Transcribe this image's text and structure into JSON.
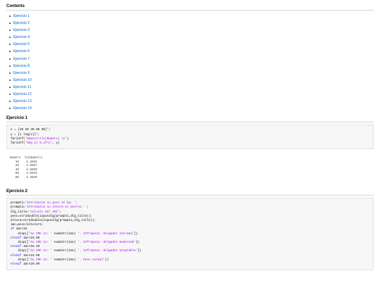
{
  "contents": {
    "title": "Contents",
    "items": [
      "Ejercicio 1",
      "Ejercicio 2",
      "Ejercicio 3",
      "Ejercicio 4",
      "Ejercicio 5",
      "Ejercicio 6",
      "Ejercicio 7",
      "Ejercicio 8",
      "Ejercicio 9",
      "Ejercicio 10",
      "Ejercicio 11",
      "Ejercicio 12",
      "Ejercicio 13",
      "Ejercicio 14"
    ]
  },
  "section1": {
    "title": "Ejercicio 1",
    "code": [
      [
        [
          "x = [10 20 40 60 80]';",
          ""
        ]
      ],
      [
        [
          "y = [x log(x)]';",
          ""
        ]
      ],
      [
        [
          "fprintf(",
          ""
        ],
        [
          "'Numero\\tln(Numero) \\n'",
          "str"
        ],
        [
          ")",
          ""
        ]
      ],
      [
        [
          "fprintf(",
          ""
        ],
        [
          "'%5g it %.4f\\n'",
          "str"
        ],
        [
          ", y)",
          ""
        ]
      ]
    ],
    "output": [
      "Numero  ln(Numero)",
      "   10    2.3026",
      "   20    2.9957",
      "   40    3.6889",
      "   60    4.0943",
      "   80    4.3820"
    ]
  },
  "section2": {
    "title": "Ejercicio 2",
    "code": [
      [
        [
          "prompt1=",
          ""
        ],
        [
          "'Introduzca su peso en kg: '",
          "str"
        ],
        [
          ";",
          ""
        ]
      ],
      [
        [
          "prompt2=",
          ""
        ],
        [
          "'Introduzca su altura en metros: '",
          "str"
        ],
        [
          ";",
          ""
        ]
      ],
      [
        [
          "dlg_title=",
          ""
        ],
        [
          "'Calculo del IMC'",
          "str"
        ],
        [
          ";",
          ""
        ]
      ],
      [
        [
          "peso=str2double(inputdlg(prompt1,dlg_title));",
          ""
        ]
      ],
      [
        [
          "altura=str2double(inputdlg(prompt2,dlg_title));",
          ""
        ]
      ],
      [
        [
          "imc=peso/altura^2;",
          ""
        ]
      ],
      [
        [
          "if",
          "kw"
        ],
        [
          " imc<16",
          ""
        ]
      ],
      [
        [
          "    disp([",
          ""
        ],
        [
          "'Su IMC es: '",
          "str"
        ],
        [
          " num2str(imc) ",
          ""
        ],
        [
          "'. Infrapeso: delgadez extrema'",
          "str"
        ],
        [
          "])",
          ""
        ]
      ],
      [
        [
          "elseif",
          "kw"
        ],
        [
          " imc<16.99",
          ""
        ]
      ],
      [
        [
          "    disp([",
          ""
        ],
        [
          "'Su IMC es: '",
          "str"
        ],
        [
          " num2str(imc) ",
          ""
        ],
        [
          "'. Infrapeso: delgadez moderada'",
          "str"
        ],
        [
          "])",
          ""
        ]
      ],
      [
        [
          "elseif",
          "kw"
        ],
        [
          " imc<18.49",
          ""
        ]
      ],
      [
        [
          "    disp([",
          ""
        ],
        [
          "'Su IMC es: '",
          "str"
        ],
        [
          " num2str(imc) ",
          ""
        ],
        [
          "'. Infrapeso: delgadez aceptable'",
          "str"
        ],
        [
          "])",
          ""
        ]
      ],
      [
        [
          "elseif",
          "kw"
        ],
        [
          " imc<24.99",
          ""
        ]
      ],
      [
        [
          "    disp([",
          ""
        ],
        [
          "'Su IMC es: '",
          "str"
        ],
        [
          " num2str(imc) ",
          ""
        ],
        [
          "'. Peso normal'",
          "str"
        ],
        [
          "])",
          ""
        ]
      ],
      [
        [
          "elseif",
          "kw"
        ],
        [
          " imc<29.99",
          ""
        ]
      ]
    ]
  }
}
